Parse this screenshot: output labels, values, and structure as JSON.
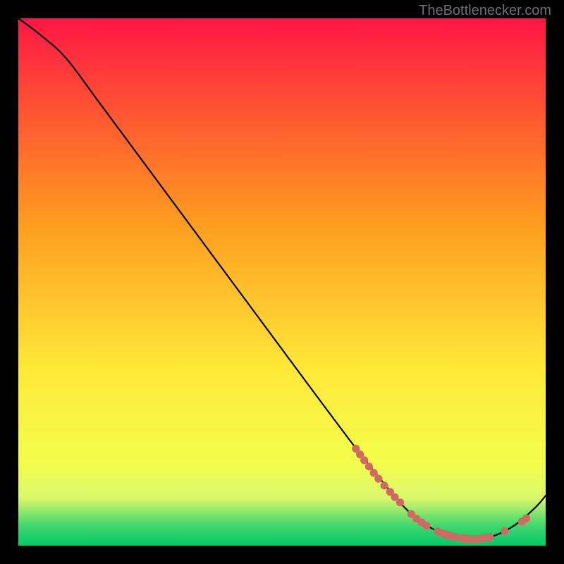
{
  "watermark": "TheBottlenecker.com",
  "chart_data": {
    "type": "line",
    "title": "",
    "xlabel": "",
    "ylabel": "",
    "xlim": [
      0,
      100
    ],
    "ylim": [
      0,
      100
    ],
    "grid": false,
    "gradient": {
      "top": "#ff1744",
      "mid_upper": "#ff9a1f",
      "mid": "#ffe838",
      "mid_lower": "#f4fd4b",
      "band_light": "#daf86b",
      "band_green": "#43d96f",
      "bottom": "#00c96a"
    },
    "curve": [
      {
        "x": 0,
        "y": 100
      },
      {
        "x": 4,
        "y": 97
      },
      {
        "x": 9,
        "y": 92.5
      },
      {
        "x": 15,
        "y": 84.5
      },
      {
        "x": 25,
        "y": 71
      },
      {
        "x": 35,
        "y": 57.5
      },
      {
        "x": 45,
        "y": 44
      },
      {
        "x": 55,
        "y": 30.5
      },
      {
        "x": 64,
        "y": 18.5
      },
      {
        "x": 70,
        "y": 11
      },
      {
        "x": 74,
        "y": 6.5
      },
      {
        "x": 78,
        "y": 3.5
      },
      {
        "x": 82,
        "y": 1.8
      },
      {
        "x": 86,
        "y": 1.2
      },
      {
        "x": 90,
        "y": 1.8
      },
      {
        "x": 94,
        "y": 3.8
      },
      {
        "x": 98,
        "y": 7.2
      },
      {
        "x": 100,
        "y": 9.5
      }
    ],
    "markers": [
      {
        "x": 64.0,
        "y": 18.4
      },
      {
        "x": 64.8,
        "y": 17.3
      },
      {
        "x": 65.6,
        "y": 16.2
      },
      {
        "x": 66.5,
        "y": 15.0
      },
      {
        "x": 67.4,
        "y": 13.8
      },
      {
        "x": 68.3,
        "y": 12.7
      },
      {
        "x": 69.4,
        "y": 11.4
      },
      {
        "x": 70.5,
        "y": 10.2
      },
      {
        "x": 71.4,
        "y": 9.2
      },
      {
        "x": 72.4,
        "y": 8.2
      },
      {
        "x": 74.5,
        "y": 6.0
      },
      {
        "x": 75.5,
        "y": 5.1
      },
      {
        "x": 76.5,
        "y": 4.4
      },
      {
        "x": 77.4,
        "y": 3.8
      },
      {
        "x": 79.5,
        "y": 2.7
      },
      {
        "x": 80.3,
        "y": 2.4
      },
      {
        "x": 80.9,
        "y": 2.2
      },
      {
        "x": 81.5,
        "y": 2.0
      },
      {
        "x": 82.1,
        "y": 1.9
      },
      {
        "x": 82.8,
        "y": 1.7
      },
      {
        "x": 83.9,
        "y": 1.5
      },
      {
        "x": 84.5,
        "y": 1.4
      },
      {
        "x": 85.1,
        "y": 1.35
      },
      {
        "x": 86.0,
        "y": 1.3
      },
      {
        "x": 86.8,
        "y": 1.3
      },
      {
        "x": 87.7,
        "y": 1.4
      },
      {
        "x": 88.4,
        "y": 1.5
      },
      {
        "x": 89.4,
        "y": 1.7
      },
      {
        "x": 92.2,
        "y": 2.8
      },
      {
        "x": 95.5,
        "y": 4.6
      },
      {
        "x": 96.3,
        "y": 5.2
      }
    ],
    "marker_color": "#cf6a63",
    "line_color": "#000000"
  }
}
